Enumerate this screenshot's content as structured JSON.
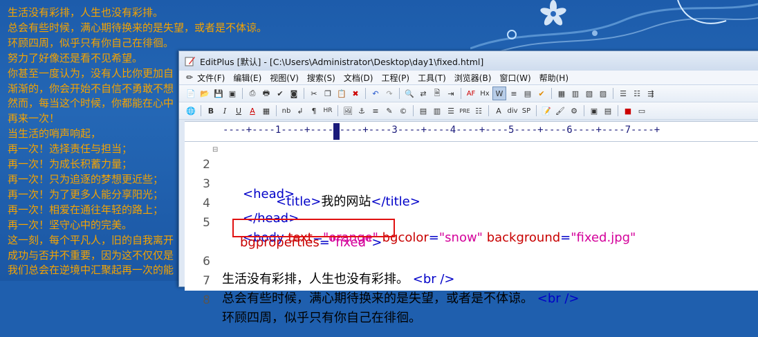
{
  "background_page": {
    "lines": [
      "生活没有彩排，人生也没有彩排。",
      "总会有些时候，满心期待换来的是失望，或者是不体谅。",
      "环顾四周，似乎只有你自己在徘徊。",
      "努力了好像还是看不见希望。",
      "你甚至一度认为，没有人比你更加自",
      "渐渐的，你会开始不自信不勇敢不想",
      "然而，每当这个时候，你都能在心中",
      "再来一次！",
      "当生活的哨声响起，",
      "再一次！选择责任与担当；",
      "再一次！为成长积蓄力量；",
      "再一次！只为追逐的梦想更近些；",
      "再一次！为了更多人能分享阳光；",
      "再一次！相爱在通往年轻的路上；",
      "再一次！坚守心中的完美。",
      "这一刻，每个平凡人，旧的自我离开",
      "成功与否并不重要，因为这不仅仅是",
      "我们总会在逆境中汇聚起再一次的能"
    ]
  },
  "editor": {
    "title": "EditPlus [默认] - [C:\\Users\\Administrator\\Desktop\\day1\\fixed.html]",
    "menu": [
      "文件(F)",
      "编辑(E)",
      "视图(V)",
      "搜索(S)",
      "文档(D)",
      "工程(P)",
      "工具(T)",
      "浏览器(B)",
      "窗口(W)",
      "帮助(H)"
    ],
    "toolbar2_labels": {
      "bold": "B",
      "italic": "I",
      "underline": "U",
      "font_color": "A",
      "nb": "nb",
      "br": "↲",
      "para": "¶",
      "hr": "HR",
      "pre": "PRE",
      "div": "div",
      "sp": "SP",
      "hx": "Hx",
      "af": "AF"
    },
    "ruler": "----+----1----+----2----+----3----+----4----+----5----+----6----+----7----+",
    "lines": {
      "l2": {
        "num": "2",
        "t1": "<head>"
      },
      "l3": {
        "num": "3",
        "t1": "<title>",
        "text": "我的网站",
        "t2": "</title>"
      },
      "l4": {
        "num": "4",
        "t1": "</head>"
      },
      "l5": {
        "num": "5",
        "t1": "<body ",
        "a1": "text",
        "eq1": "=",
        "v1": "\"orange\"",
        "a2": " bgcolor",
        "eq2": "=",
        "v2": "\"snow\"",
        "a3": " background",
        "eq3": "=",
        "v3": "\"fixed.jpg\""
      },
      "l5b": {
        "a1": "bgproperties",
        "eq1": "=",
        "v1": "\"fixed\"",
        "t1": ">"
      },
      "l6": {
        "num": "6",
        "text": "生活没有彩排，人生也没有彩排。",
        "t1": "<br />"
      },
      "l7": {
        "num": "7",
        "text": "总会有些时候，满心期待换来的是失望，或者是不体谅。",
        "t1": "<br />"
      },
      "l8": {
        "num": "8",
        "text": "环顾四周，似乎只有你自己在徘徊。"
      }
    }
  },
  "colors": {
    "page_text": "#f5a300",
    "page_bg": "#1f5fae",
    "tag": "#0000c8",
    "attribute": "#c80000",
    "value": "#d4009a",
    "highlight_box": "#e01010"
  }
}
